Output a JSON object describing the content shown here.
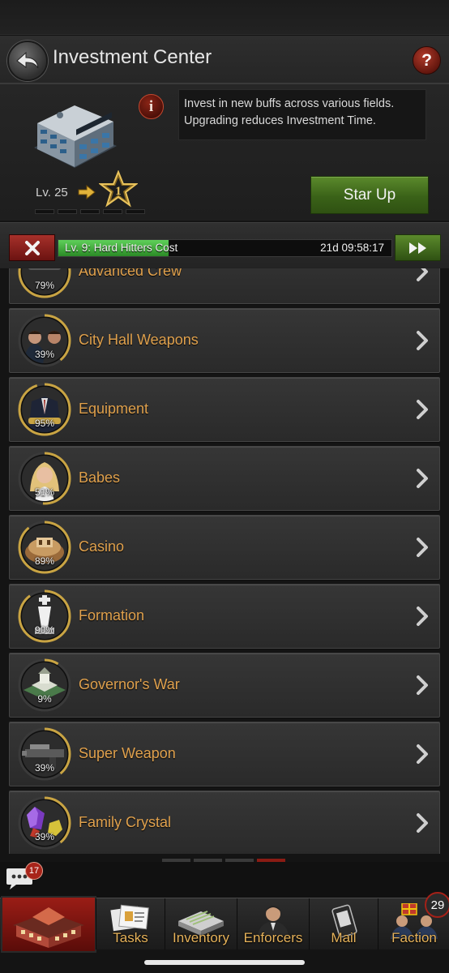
{
  "header": {
    "title": "Investment Center",
    "help_symbol": "?"
  },
  "building": {
    "level": "Lv. 25",
    "next_star": "1",
    "info_symbol": "i",
    "description": "Invest in new buffs across various fields. Upgrading reduces Investment Time.",
    "star_up_label": "Star Up"
  },
  "queue": {
    "label": "Lv. 9: Hard Hitters Cost",
    "timer": "21d 09:58:17",
    "progress": 0.33
  },
  "categories": [
    {
      "name": "Advanced Crew",
      "percent": "79%",
      "progress": 0.79,
      "icon": "crew-icon"
    },
    {
      "name": "City Hall Weapons",
      "percent": "39%",
      "progress": 0.39,
      "icon": "gangsters-icon"
    },
    {
      "name": "Equipment",
      "percent": "95%",
      "progress": 0.95,
      "icon": "suit-icon"
    },
    {
      "name": "Babes",
      "percent": "51%",
      "progress": 0.51,
      "icon": "babe-icon"
    },
    {
      "name": "Casino",
      "percent": "89%",
      "progress": 0.89,
      "icon": "casino-icon"
    },
    {
      "name": "Formation",
      "percent": "90%",
      "progress": 0.9,
      "icon": "chess-king-icon"
    },
    {
      "name": "Governor's War",
      "percent": "9%",
      "progress": 0.09,
      "icon": "city-hall-icon"
    },
    {
      "name": "Super Weapon",
      "percent": "39%",
      "progress": 0.39,
      "icon": "machine-gun-icon"
    },
    {
      "name": "Family Crystal",
      "percent": "39%",
      "progress": 0.39,
      "icon": "crystal-icon"
    }
  ],
  "chat": {
    "unread": "17"
  },
  "nav": {
    "tasks": "Tasks",
    "inventory": "Inventory",
    "enforcers": "Enforcers",
    "mail": "Mail",
    "faction": "Faction",
    "faction_badge": "29"
  },
  "colors": {
    "accent_orange": "#e0a14d",
    "progress_green": "#3fb13a",
    "ring_gold": "#c9a443",
    "alert_red": "#a8241a"
  }
}
